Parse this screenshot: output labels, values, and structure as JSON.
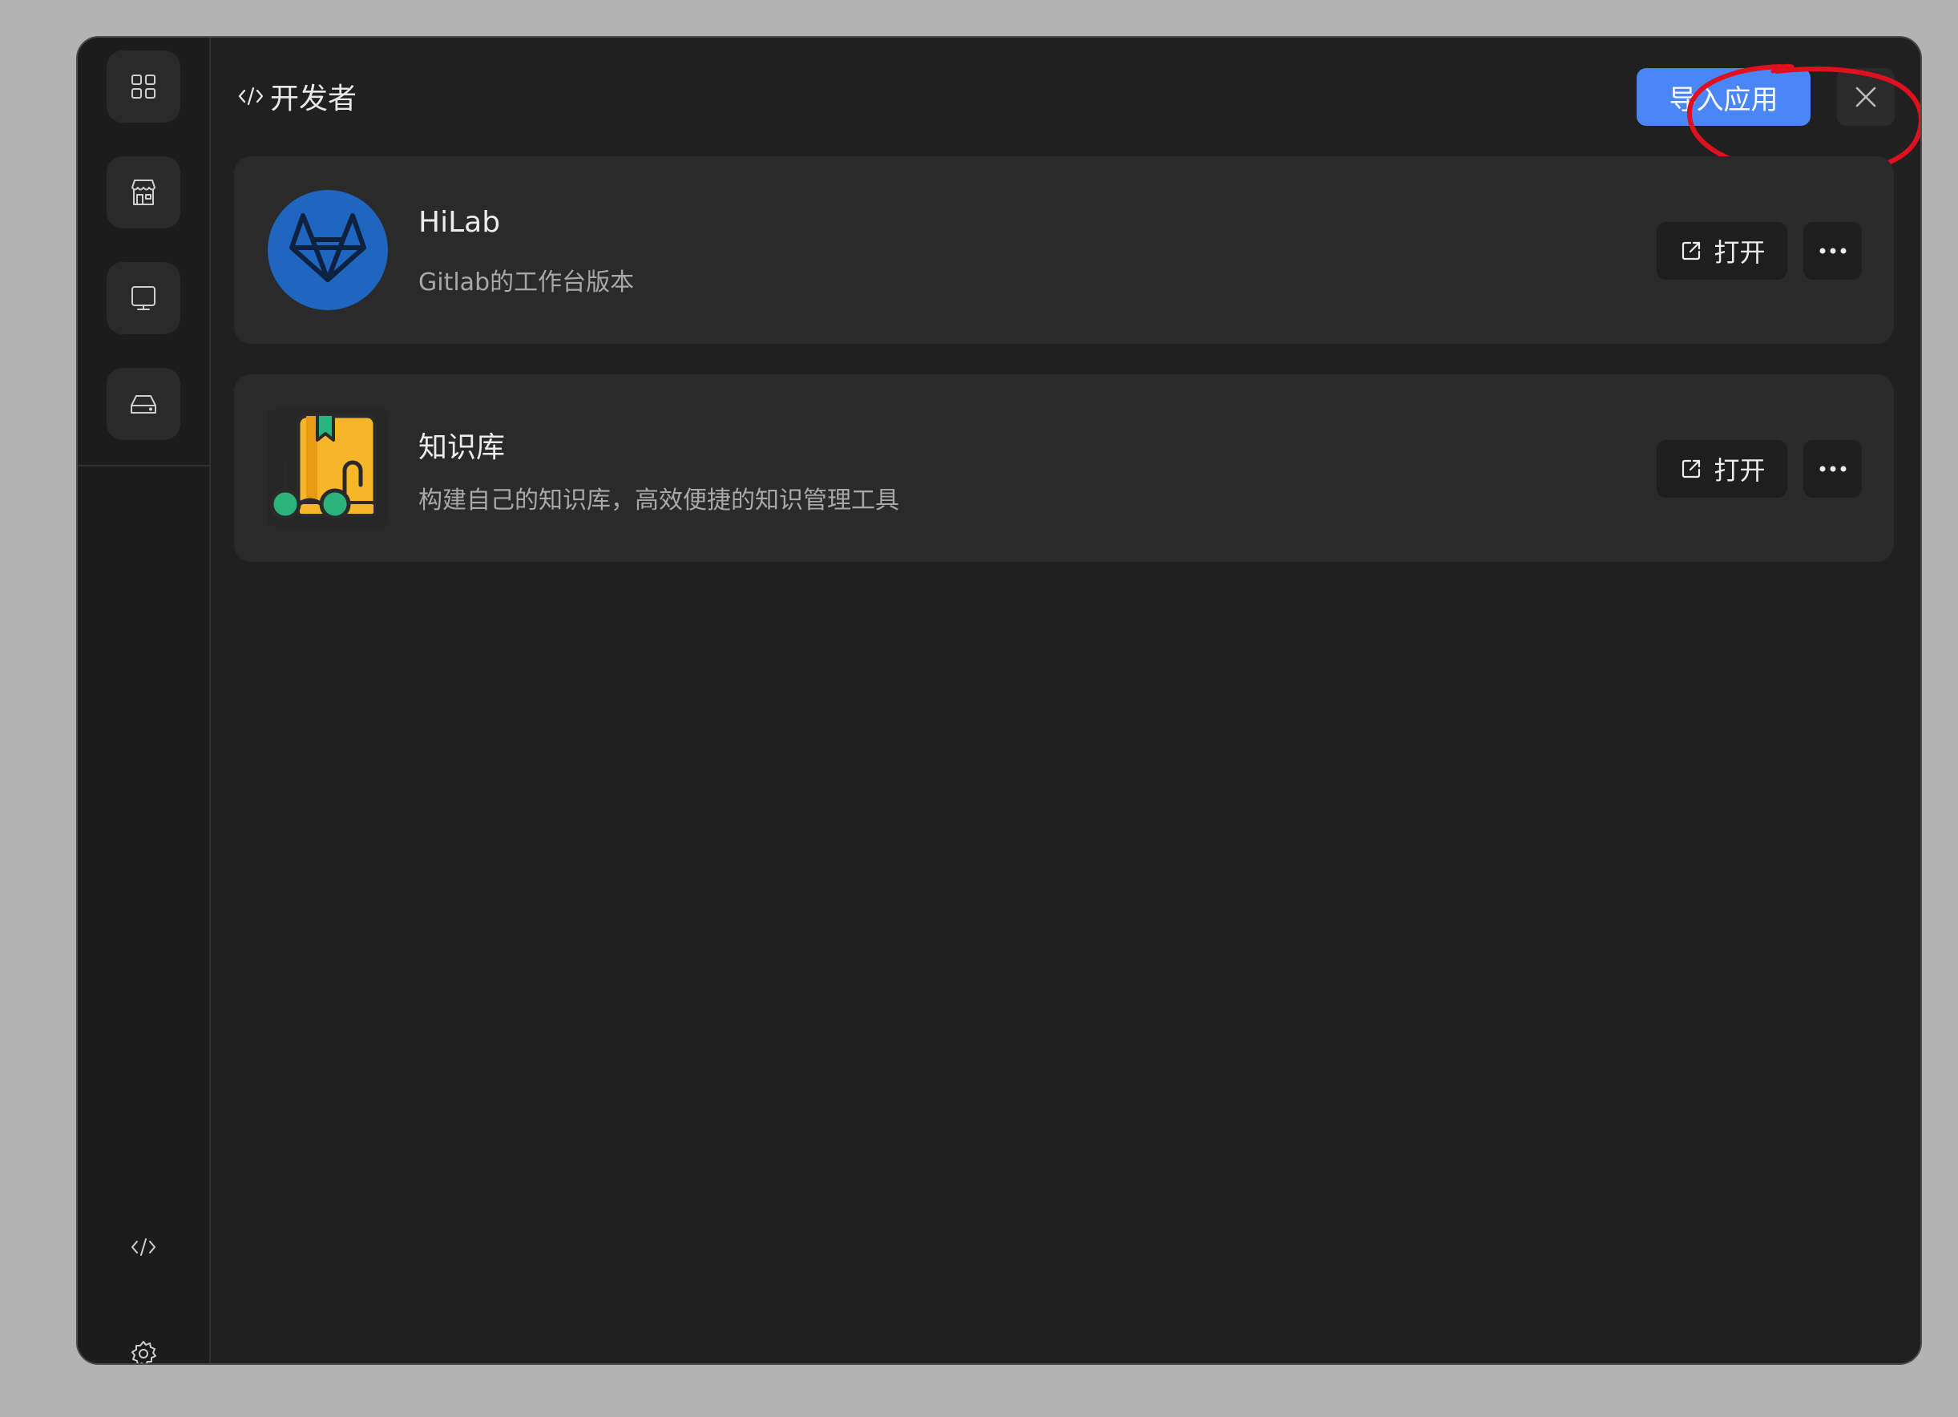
{
  "header": {
    "title": "开发者",
    "title_icon": "code-icon",
    "import_label": "导入应用",
    "close_icon": "close-icon"
  },
  "sidebar": {
    "items": [
      {
        "icon": "apps-grid-icon"
      },
      {
        "icon": "store-icon"
      },
      {
        "icon": "monitor-icon"
      },
      {
        "icon": "drive-icon"
      }
    ],
    "bottom": [
      {
        "icon": "code-icon"
      },
      {
        "icon": "gear-icon"
      }
    ]
  },
  "apps": [
    {
      "name": "HiLab",
      "description": "Gitlab的工作台版本",
      "icon": "gitlab-logo",
      "open_label": "打开"
    },
    {
      "name": "知识库",
      "description": "构建自己的知识库，高效便捷的知识管理工具",
      "icon": "knowledge-book-logo",
      "open_label": "打开"
    }
  ],
  "colors": {
    "accent": "#4a86f5",
    "annotation": "#e0101e",
    "background": "#202020",
    "card": "#2a2a2a"
  }
}
